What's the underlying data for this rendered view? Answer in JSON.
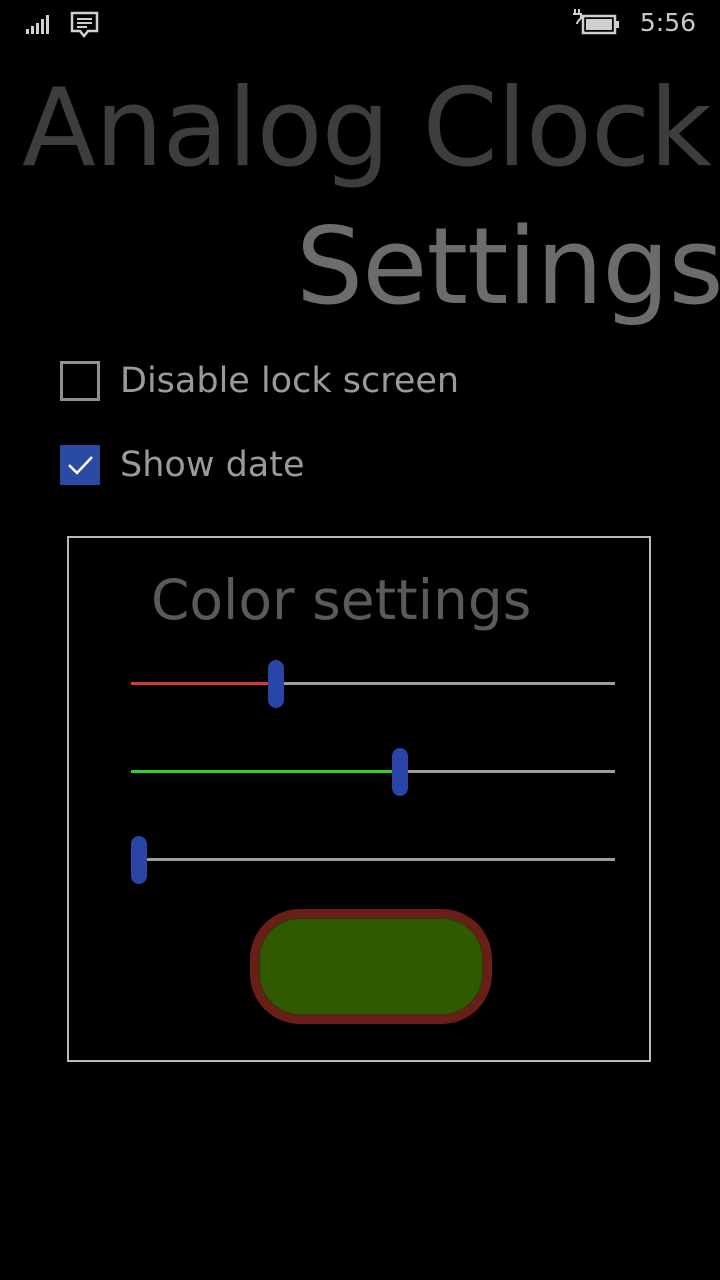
{
  "status_bar": {
    "time": "5:56",
    "icons": [
      "signal-icon",
      "message-icon",
      "battery-charging-icon"
    ]
  },
  "title": {
    "line1": "Analog Clock",
    "line2": "Settings"
  },
  "options": [
    {
      "label": "Disable lock screen",
      "checked": false
    },
    {
      "label": "Show date",
      "checked": true
    }
  ],
  "color_settings": {
    "title": "Color settings",
    "sliders": [
      {
        "channel": "red",
        "value": 0.3,
        "fill_color": "#d23a3a"
      },
      {
        "channel": "green",
        "value": 0.555,
        "fill_color": "#33cc33"
      },
      {
        "channel": "blue",
        "value": 0.016,
        "fill_color": "#9e9e9e"
      }
    ],
    "preview_fill": "#2f5a00",
    "preview_border": "#6a1e18"
  },
  "colors": {
    "accent": "#2a44a8",
    "background": "#000000"
  }
}
